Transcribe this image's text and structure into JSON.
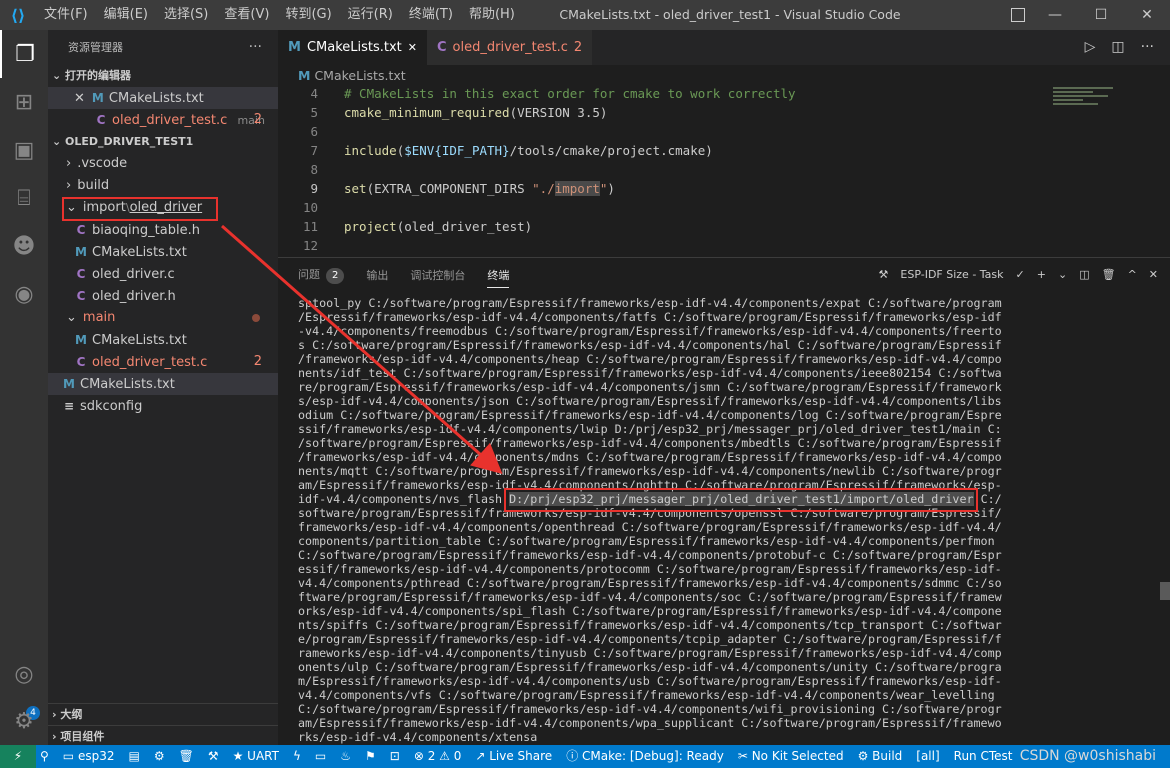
{
  "window": {
    "title": "CMakeLists.txt - oled_driver_test1 - Visual Studio Code",
    "menu": [
      "文件(F)",
      "编辑(E)",
      "选择(S)",
      "查看(V)",
      "转到(G)",
      "运行(R)",
      "终端(T)",
      "帮助(H)"
    ],
    "controls": {
      "minimize": "—",
      "maximize": "☐",
      "close": "✕"
    }
  },
  "sidebar": {
    "header": "资源管理器",
    "more": "···",
    "open_editors_label": "打开的编辑器",
    "open_editors": [
      {
        "close": "✕",
        "icon": "M",
        "name": "CMakeLists.txt"
      },
      {
        "icon": "C",
        "name": "oled_driver_test.c",
        "folder": "main",
        "problems": "2"
      }
    ],
    "project_label": "OLED_DRIVER_TEST1",
    "tree": [
      {
        "chevron": "›",
        "name": ".vscode"
      },
      {
        "chevron": "›",
        "name": "build"
      },
      {
        "chevron": "⌄",
        "name_a": "import",
        "sep": "\\",
        "name_b": "oled_driver"
      },
      {
        "icon": "C",
        "name": "biaoqing_table.h"
      },
      {
        "icon": "M",
        "name": "CMakeLists.txt"
      },
      {
        "icon": "C",
        "name": "oled_driver.c"
      },
      {
        "icon": "C",
        "name": "oled_driver.h"
      },
      {
        "chevron": "⌄",
        "name": "main"
      },
      {
        "icon": "M",
        "name": "CMakeLists.txt"
      },
      {
        "icon": "C",
        "name": "oled_driver_test.c",
        "problems": "2"
      },
      {
        "icon": "M",
        "name": "CMakeLists.txt"
      },
      {
        "icon": "≡",
        "name": "sdkconfig"
      }
    ],
    "outline_label": "大纲",
    "components_label": "项目组件"
  },
  "tabs": [
    {
      "icon": "M",
      "label": "CMakeLists.txt",
      "close": "✕"
    },
    {
      "icon": "C",
      "label": "oled_driver_test.c",
      "count": "2"
    }
  ],
  "breadcrumb": {
    "icon": "M",
    "label": "CMakeLists.txt"
  },
  "code": {
    "lines": [
      {
        "n": "4",
        "text": "# CMakeLists in this exact order for cmake to work correctly"
      },
      {
        "n": "5",
        "fn": "cmake_minimum_required",
        "rest": "(VERSION 3.5)"
      },
      {
        "n": "6"
      },
      {
        "n": "7",
        "fn": "include",
        "a": "(",
        "var": "$ENV{IDF_PATH}",
        "b": "/tools/cmake/project.cmake)"
      },
      {
        "n": "8"
      },
      {
        "n": "9",
        "fn": "set",
        "a": "(EXTRA_COMPONENT_DIRS ",
        "s1": "\"./",
        "s2": "import",
        "s3": "\"",
        "b": ")"
      },
      {
        "n": "10"
      },
      {
        "n": "11",
        "fn": "project",
        "rest": "(oled_driver_test)"
      },
      {
        "n": "12"
      }
    ]
  },
  "panel": {
    "tabs": [
      "问题",
      "输出",
      "调试控制台",
      "终端"
    ],
    "problems_count": "2",
    "task_label": "ESP-IDF Size - Task",
    "actions": [
      "✓",
      "+",
      "⌄",
      "◫",
      "🗑",
      "^",
      "✕"
    ],
    "terminal_lines": [
      "sptool_py C:/software/program/Espressif/frameworks/esp-idf-v4.4/components/expat C:/software/program",
      "/Espressif/frameworks/esp-idf-v4.4/components/fatfs C:/software/program/Espressif/frameworks/esp-idf",
      "-v4.4/components/freemodbus C:/software/program/Espressif/frameworks/esp-idf-v4.4/components/freerto",
      "s C:/software/program/Espressif/frameworks/esp-idf-v4.4/components/hal C:/software/program/Espressif",
      "/frameworks/esp-idf-v4.4/components/heap C:/software/program/Espressif/frameworks/esp-idf-v4.4/compo",
      "nents/idf_test C:/software/program/Espressif/frameworks/esp-idf-v4.4/components/ieee802154 C:/softwa",
      "re/program/Espressif/frameworks/esp-idf-v4.4/components/jsmn C:/software/program/Espressif/framework",
      "s/esp-idf-v4.4/components/json C:/software/program/Espressif/frameworks/esp-idf-v4.4/components/libs",
      "odium C:/software/program/Espressif/frameworks/esp-idf-v4.4/components/log C:/software/program/Espre",
      "ssif/frameworks/esp-idf-v4.4/components/lwip D:/prj/esp32_prj/messager_prj/oled_driver_test1/main C:",
      "/software/program/Espressif/frameworks/esp-idf-v4.4/components/mbedtls C:/software/program/Espressif",
      "/frameworks/esp-idf-v4.4/components/mdns C:/software/program/Espressif/frameworks/esp-idf-v4.4/compo",
      "nents/mqtt C:/software/program/Espressif/frameworks/esp-idf-v4.4/components/newlib C:/software/progr",
      "am/Espressif/frameworks/esp-idf-v4.4/components/nghttp C:/software/program/Espressif/frameworks/esp-",
      "idf-v4.4/components/nvs_flash ",
      "software/program/Espressif/frameworks/esp-idf-v4.4/components/openssl C:/software/program/Espressif/",
      "frameworks/esp-idf-v4.4/components/openthread C:/software/program/Espressif/frameworks/esp-idf-v4.4/",
      "components/partition_table C:/software/program/Espressif/frameworks/esp-idf-v4.4/components/perfmon",
      "C:/software/program/Espressif/frameworks/esp-idf-v4.4/components/protobuf-c C:/software/program/Espr",
      "essif/frameworks/esp-idf-v4.4/components/protocomm C:/software/program/Espressif/frameworks/esp-idf-",
      "v4.4/components/pthread C:/software/program/Espressif/frameworks/esp-idf-v4.4/components/sdmmc C:/so",
      "ftware/program/Espressif/frameworks/esp-idf-v4.4/components/soc C:/software/program/Espressif/framew",
      "orks/esp-idf-v4.4/components/spi_flash C:/software/program/Espressif/frameworks/esp-idf-v4.4/compone",
      "nts/spiffs C:/software/program/Espressif/frameworks/esp-idf-v4.4/components/tcp_transport C:/softwar",
      "e/program/Espressif/frameworks/esp-idf-v4.4/components/tcpip_adapter C:/software/program/Espressif/f",
      "rameworks/esp-idf-v4.4/components/tinyusb C:/software/program/Espressif/frameworks/esp-idf-v4.4/comp",
      "onents/ulp C:/software/program/Espressif/frameworks/esp-idf-v4.4/components/unity C:/software/progra",
      "m/Espressif/frameworks/esp-idf-v4.4/components/usb C:/software/program/Espressif/frameworks/esp-idf-",
      "v4.4/components/vfs C:/software/program/Espressif/frameworks/esp-idf-v4.4/components/wear_levelling",
      "C:/software/program/Espressif/frameworks/esp-idf-v4.4/components/wifi_provisioning C:/software/progr",
      "am/Espressif/frameworks/esp-idf-v4.4/components/wpa_supplicant C:/software/program/Espressif/framewo",
      "rks/esp-idf-v4.4/components/xtensa"
    ],
    "highlighted_path": "D:/prj/esp32_prj/messager_prj/oled_driver_test1/import/oled_driver",
    "after_highlight": " C:/"
  },
  "status": {
    "remote": "⚡",
    "target": "esp32",
    "uart": "UART",
    "problems": "⊗ 2 ⚠ 0",
    "live_share": "Live Share",
    "cmake": "CMake: [Debug]: Ready",
    "kit": "No Kit Selected",
    "build": "Build",
    "all": "[all]",
    "run": "Run CTest",
    "watermark": "CSDN @w0shishabi"
  },
  "colors": {
    "accent": "#007acc",
    "annotation_red": "#e8322d",
    "error_red": "#f48771"
  }
}
